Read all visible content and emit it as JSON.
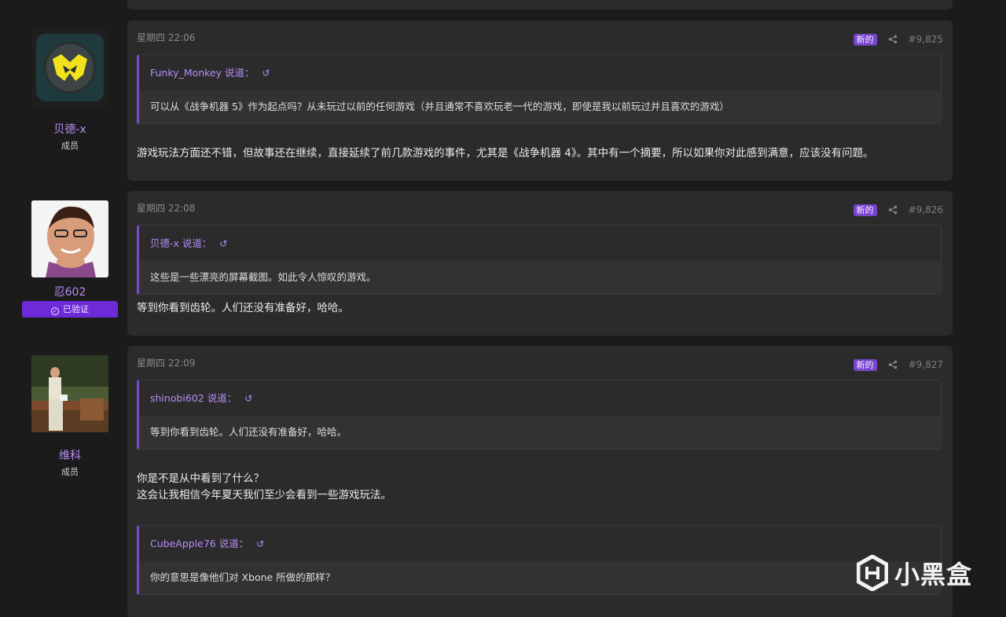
{
  "posts": [
    {
      "author": "贝德-x",
      "role": "成员",
      "date": "星期四 22:06",
      "new_badge": "新的",
      "number": "#9,825",
      "quote": {
        "author": "Funky_Monkey 说道：",
        "text": "可以从《战争机器 5》作为起点吗？从未玩过以前的任何游戏（并且通常不喜欢玩老一代的游戏，即使是我以前玩过并且喜欢的游戏）"
      },
      "body": "游戏玩法方面还不错，但故事还在继续，直接延续了前几款游戏的事件，尤其是《战争机器 4》。其中有一个摘要，所以如果你对此感到满意，应该没有问题。"
    },
    {
      "author": "忍602",
      "verified": "已验证",
      "date": "星期四 22:08",
      "new_badge": "新的",
      "number": "#9,826",
      "quote": {
        "author": "贝德-x 说道：",
        "text": "这些是一些漂亮的屏幕截图。如此令人惊叹的游戏。"
      },
      "body": "等到你看到齿轮。人们还没有准备好，哈哈。"
    },
    {
      "author": "维科",
      "role": "成员",
      "date": "星期四 22:09",
      "new_badge": "新的",
      "number": "#9,827",
      "quote": {
        "author": "shinobi602 说道：",
        "text": "等到你看到齿轮。人们还没有准备好，哈哈。"
      },
      "body_line1": "你是不是从中看到了什么？",
      "body_line2": "这会让我相信今年夏天我们至少会看到一些游戏玩法。",
      "quote2": {
        "author": "CubeApple76 说道：",
        "text": "你的意思是像他们对 Xbone 所做的那样？"
      }
    }
  ],
  "watermark": "小黑盒",
  "colors": {
    "accent": "#b58ef5",
    "badge": "#7a44cf",
    "verified": "#6d2ad8",
    "card": "#2b2b2c"
  }
}
